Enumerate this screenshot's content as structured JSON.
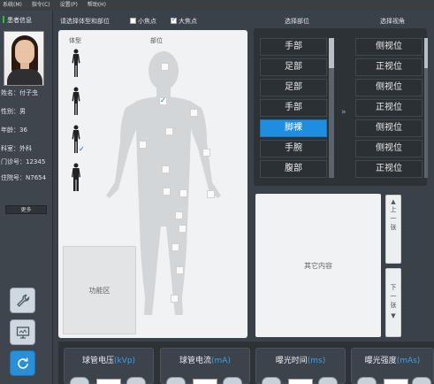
{
  "menu": [
    "系统(M)",
    "指令(C)",
    "设置(P)",
    "帮助(H)"
  ],
  "patient": {
    "title": "患者信息",
    "name": "姓名：付子虫",
    "gender": "性别：男",
    "age": "年龄：36",
    "dept": "科室：外科",
    "clinic_no": "门诊号：12345",
    "inpatient_no": "住院号：N7654",
    "more_label": "更多"
  },
  "center": {
    "heading": "请选择体型和部位",
    "small_focus": "小焦点",
    "large_focus": "大焦点",
    "body_type_label": "体型",
    "part_label": "部位",
    "function_area": "功能区"
  },
  "select_part": {
    "heading": "选择部位",
    "items": [
      "手部",
      "足部",
      "足部",
      "手部",
      "脚裸",
      "手腕",
      "腹部"
    ],
    "selected_index": 4
  },
  "select_view": {
    "heading": "选择视角",
    "items": [
      "侧视位",
      "正视位",
      "侧视位",
      "正视位",
      "侧视位",
      "侧视位",
      "正视位"
    ]
  },
  "other_content": "其它内容",
  "pager": {
    "prev": [
      "上",
      "一",
      "张"
    ],
    "next": [
      "下",
      "一",
      "张"
    ]
  },
  "params": [
    {
      "label": "球管电压",
      "unit": "(kVp)"
    },
    {
      "label": "球管电流",
      "unit": "(mA)"
    },
    {
      "label": "曝光时间",
      "unit": "(ms)"
    },
    {
      "label": "曝光强度",
      "unit": "(mAs)"
    }
  ],
  "colors": {
    "accent": "#1d8ee0",
    "unit": "#3aa0f0",
    "status_green": "#2fbf3a"
  }
}
